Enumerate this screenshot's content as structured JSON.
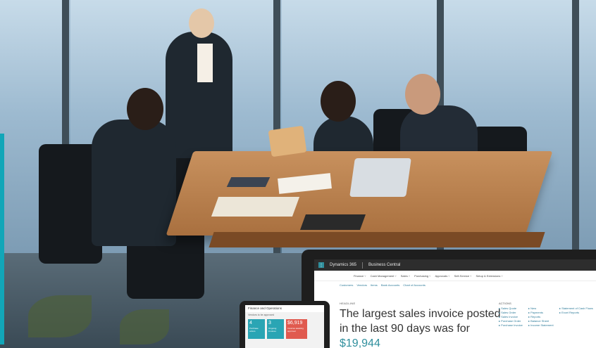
{
  "business_central": {
    "product": "Dynamics 365",
    "module": "Business Central",
    "nav_menu": [
      "Finance",
      "Cash Management",
      "Sales",
      "Purchasing",
      "Approvals",
      "Self-Service",
      "Setup & Extensions"
    ],
    "links": [
      "Customers",
      "Vendors",
      "Items",
      "Bank Accounts",
      "Chart of Accounts"
    ],
    "headline_label": "HEADLINE",
    "headline_text": "The largest sales invoice posted in the last 90 days was for",
    "headline_amount": "$19,944",
    "actions_title": "ACTIONS",
    "actions_col1": [
      "Sales Quote",
      "Sales Order",
      "Sales Invoice",
      "Purchase Order",
      "Purchase Invoice"
    ],
    "actions_col2": [
      "New",
      "Payments",
      "Reports",
      "Balance Sheet",
      "Income Statement"
    ],
    "actions_col3": [
      "Statement of Cash Flows",
      "Excel Reports"
    ]
  },
  "finance_operations": {
    "title": "Finance and Operations",
    "subtitle": "Vendors to be approved",
    "tiles": [
      {
        "value": "4",
        "label": "Purchase orders",
        "color": "#2aa5b4"
      },
      {
        "value": "3",
        "label": "Ongoing invoices",
        "color": "#2aa5b4"
      },
      {
        "value": "$6,919",
        "label": "Invoices awaiting approval",
        "color": "#e05a4f"
      }
    ]
  },
  "colors": {
    "accent": "#2f8f9d",
    "sidebar_strip": "#12a6b8"
  }
}
